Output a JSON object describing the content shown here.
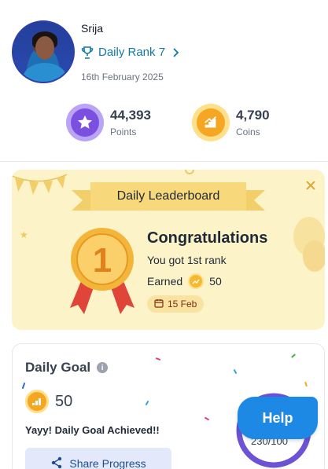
{
  "profile": {
    "name": "Srija",
    "rank_label": "Daily Rank 7",
    "date": "16th February 2025"
  },
  "stats": {
    "points_value": "44,393",
    "points_label": "Points",
    "coins_value": "4,790",
    "coins_label": "Coins"
  },
  "leaderboard": {
    "title": "Daily Leaderboard",
    "rank_number": "1",
    "heading": "Congratulations",
    "message": "You got 1st rank",
    "earned_label": "Earned",
    "earned_amount": "50",
    "date_chip": "15 Feb"
  },
  "goal": {
    "title": "Daily Goal",
    "amount": "50",
    "status": "Yayy! Daily Goal Achieved!!",
    "share_label": "Share Progress",
    "progress_text": "230/100"
  },
  "help": {
    "label": "Help"
  },
  "colors": {
    "accent": "#0e7aa8",
    "points": "#7b4fe0",
    "coins": "#f5a623",
    "card_bg": "#fdf3c9",
    "help": "#1e88e5",
    "ring": "#6d52d6"
  },
  "icons": {
    "trophy": "trophy-icon",
    "star": "star-icon",
    "coins": "coin-stack-icon",
    "close": "close-icon",
    "calendar": "calendar-icon",
    "share": "share-icon",
    "info": "info-icon"
  }
}
